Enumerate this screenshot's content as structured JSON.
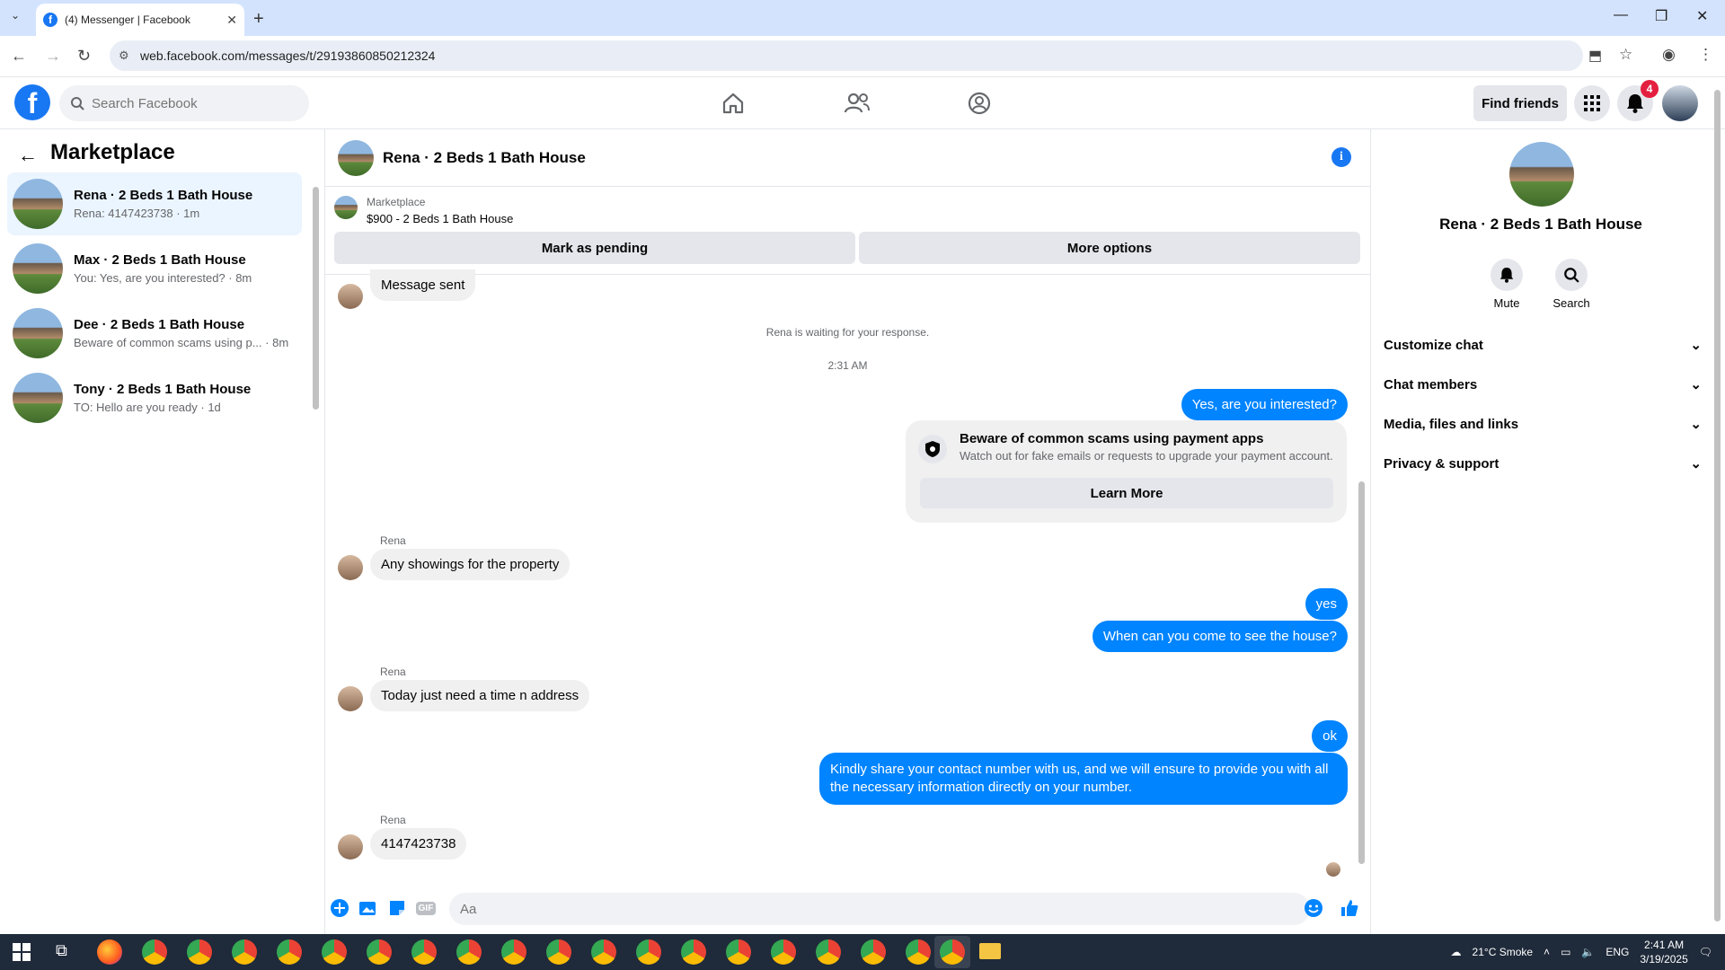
{
  "browser": {
    "tab_title": "(4) Messenger | Facebook",
    "url": "web.facebook.com/messages/t/29193860850212324"
  },
  "header": {
    "logo": "f",
    "search_placeholder": "Search Facebook",
    "find_friends": "Find friends",
    "notification_count": "4"
  },
  "sidebar": {
    "title": "Marketplace",
    "conversations": [
      {
        "name": "Rena · 2 Beds 1 Bath House",
        "preview": "Rena: 4147423738 · 1m"
      },
      {
        "name": "Max · 2 Beds 1 Bath House",
        "preview": "You: Yes, are you interested? · 8m"
      },
      {
        "name": "Dee · 2 Beds 1 Bath House",
        "preview": "Beware of common scams using p... · 8m"
      },
      {
        "name": "Tony · 2 Beds 1 Bath House",
        "preview": "TO: Hello are you ready · 1d"
      }
    ]
  },
  "chat": {
    "title": "Rena · 2 Beds 1 Bath House",
    "marketplace_label": "Marketplace",
    "listing": "$900 - 2 Beds 1 Bath House",
    "mark_pending": "Mark as pending",
    "more_options": "More options",
    "messages": {
      "m1": "Message sent",
      "waiting": "Rena is waiting for your response.",
      "time": "2:31 AM",
      "m2": "Yes, are you interested?",
      "scam_title": "Beware of common scams using payment apps",
      "scam_sub": "Watch out for fake emails or requests to upgrade your payment account.",
      "learn_more": "Learn More",
      "sender": "Rena",
      "m3": "Any showings for the property",
      "m4": "yes",
      "m5": "When can you come to see the house?",
      "m6": "Today just need a time n address",
      "m7": "ok",
      "m8a": "Kindly share your contact number with us, and we will ensure to provide you with all",
      "m8b": "the necessary information directly on your number.",
      "m9": "4147423738"
    },
    "composer_placeholder": "Aa",
    "gif": "GIF"
  },
  "right_panel": {
    "name": "Rena · 2 Beds 1 Bath House",
    "mute": "Mute",
    "search": "Search",
    "sections": [
      "Customize chat",
      "Chat members",
      "Media, files and links",
      "Privacy & support"
    ]
  },
  "taskbar": {
    "weather": "21°C  Smoke",
    "lang": "ENG",
    "time": "2:41 AM",
    "date": "3/19/2025"
  },
  "colors": {
    "brand": "#1877f2",
    "bubble_out": "#0084ff"
  }
}
